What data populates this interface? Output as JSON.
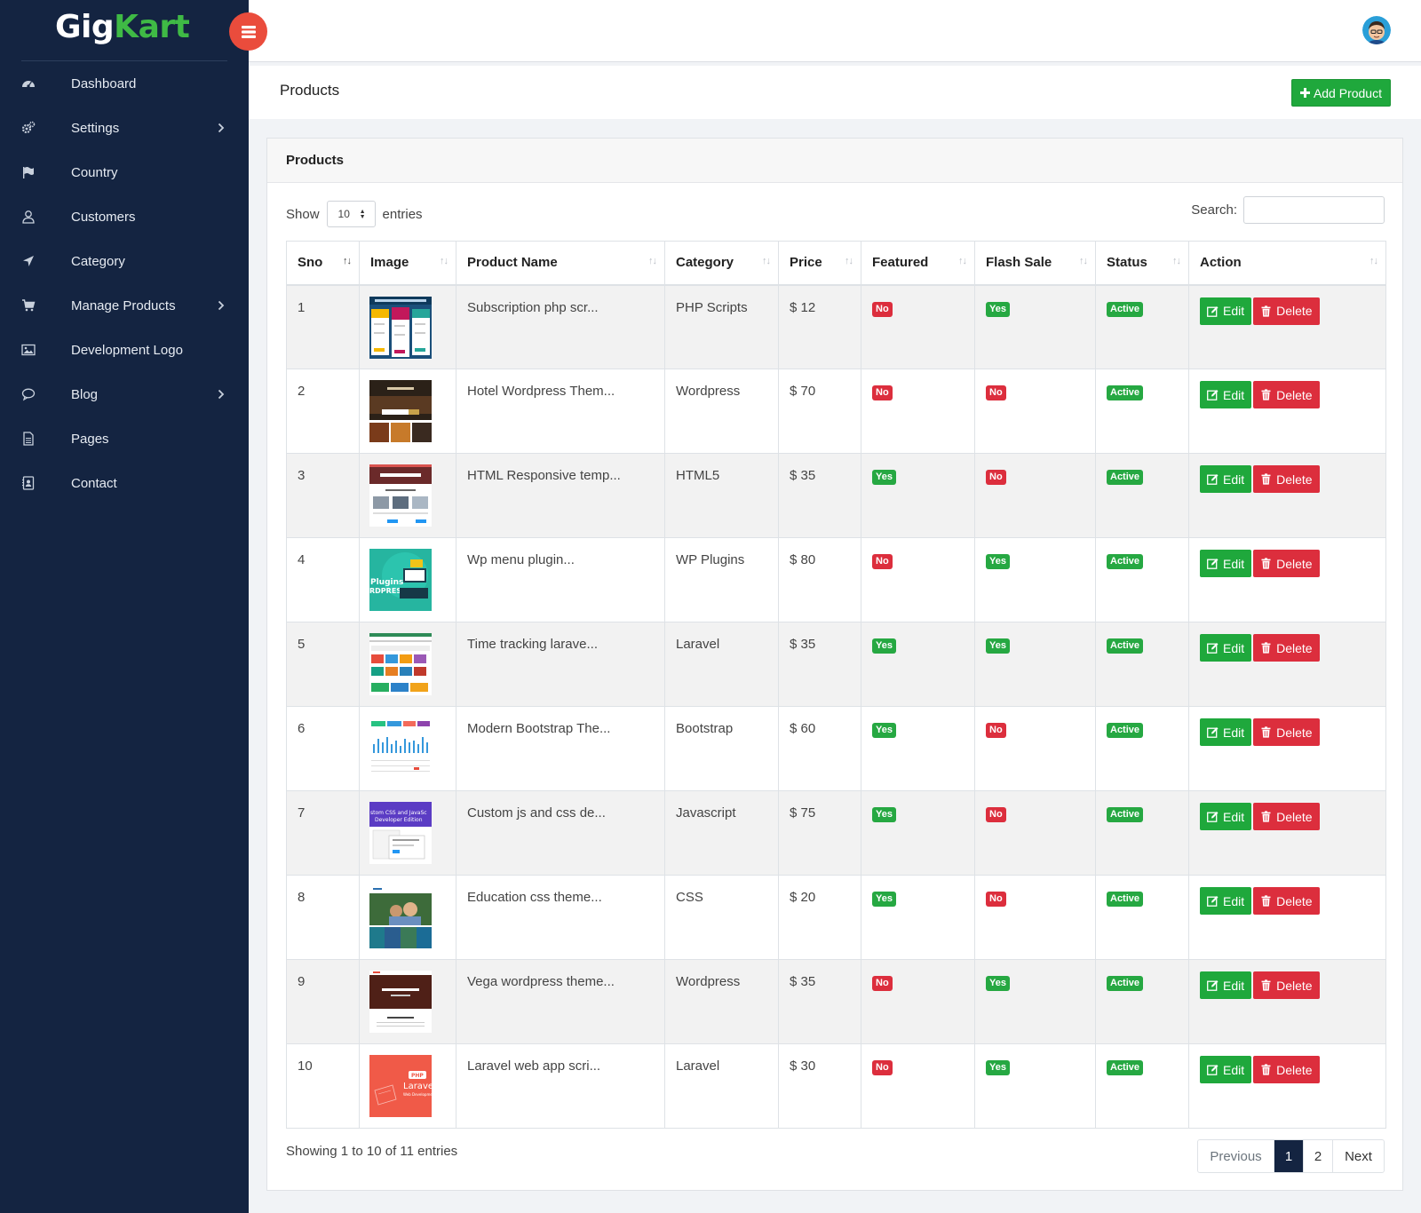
{
  "brand": {
    "part1": "Gig",
    "part2": "Kart"
  },
  "colors": {
    "sidebar": "#142441",
    "accent_green": "#1fa83c",
    "danger_red": "#dc2e3d",
    "toggle": "#ea4c3c"
  },
  "sidebar": {
    "items": [
      {
        "label": "Dashboard",
        "icon": "dashboard-icon",
        "has_submenu": false
      },
      {
        "label": "Settings",
        "icon": "gears-icon",
        "has_submenu": true
      },
      {
        "label": "Country",
        "icon": "flag-icon",
        "has_submenu": false
      },
      {
        "label": "Customers",
        "icon": "user-icon",
        "has_submenu": false
      },
      {
        "label": "Category",
        "icon": "location-arrow-icon",
        "has_submenu": false
      },
      {
        "label": "Manage Products",
        "icon": "cart-icon",
        "has_submenu": true
      },
      {
        "label": "Development Logo",
        "icon": "image-icon",
        "has_submenu": false
      },
      {
        "label": "Blog",
        "icon": "comment-icon",
        "has_submenu": true
      },
      {
        "label": "Pages",
        "icon": "file-icon",
        "has_submenu": false
      },
      {
        "label": "Contact",
        "icon": "contact-card-icon",
        "has_submenu": false
      }
    ]
  },
  "header": {
    "title": "Products",
    "add_button": "Add Product"
  },
  "card": {
    "title": "Products"
  },
  "datatable": {
    "show_label": "Show",
    "page_length": "10",
    "entries_label": "entries",
    "search_label": "Search:",
    "search_value": "",
    "columns": [
      "Sno",
      "Image",
      "Product Name",
      "Category",
      "Price",
      "Featured",
      "Flash Sale",
      "Status",
      "Action"
    ],
    "rows": [
      {
        "sno": "1",
        "name": "Subscription php scr...",
        "category": "PHP Scripts",
        "price": "$ 12",
        "featured": "No",
        "flash": "Yes",
        "status": "Active",
        "thumb": "subscription"
      },
      {
        "sno": "2",
        "name": "Hotel Wordpress Them...",
        "category": "Wordpress",
        "price": "$ 70",
        "featured": "No",
        "flash": "No",
        "status": "Active",
        "thumb": "hotel"
      },
      {
        "sno": "3",
        "name": "HTML Responsive temp...",
        "category": "HTML5",
        "price": "$ 35",
        "featured": "Yes",
        "flash": "No",
        "status": "Active",
        "thumb": "menu"
      },
      {
        "sno": "4",
        "name": "Wp menu plugin...",
        "category": "WP Plugins",
        "price": "$ 80",
        "featured": "No",
        "flash": "Yes",
        "status": "Active",
        "thumb": "plugins"
      },
      {
        "sno": "5",
        "name": "Time tracking larave...",
        "category": "Laravel",
        "price": "$ 35",
        "featured": "Yes",
        "flash": "Yes",
        "status": "Active",
        "thumb": "tracking"
      },
      {
        "sno": "6",
        "name": "Modern Bootstrap The...",
        "category": "Bootstrap",
        "price": "$ 60",
        "featured": "Yes",
        "flash": "No",
        "status": "Active",
        "thumb": "bootstrap"
      },
      {
        "sno": "7",
        "name": "Custom js and css de...",
        "category": "Javascript",
        "price": "$ 75",
        "featured": "Yes",
        "flash": "No",
        "status": "Active",
        "thumb": "customjs"
      },
      {
        "sno": "8",
        "name": "Education css theme...",
        "category": "CSS",
        "price": "$ 20",
        "featured": "Yes",
        "flash": "No",
        "status": "Active",
        "thumb": "education"
      },
      {
        "sno": "9",
        "name": "Vega wordpress theme...",
        "category": "Wordpress",
        "price": "$ 35",
        "featured": "No",
        "flash": "Yes",
        "status": "Active",
        "thumb": "vega"
      },
      {
        "sno": "10",
        "name": "Laravel web app scri...",
        "category": "Laravel",
        "price": "$ 30",
        "featured": "No",
        "flash": "Yes",
        "status": "Active",
        "thumb": "laravel"
      }
    ],
    "edit_label": "Edit",
    "delete_label": "Delete",
    "info": "Showing 1 to 10 of 11 entries",
    "pagination": {
      "previous": "Previous",
      "pages": [
        "1",
        "2"
      ],
      "current": "1",
      "next": "Next"
    }
  }
}
